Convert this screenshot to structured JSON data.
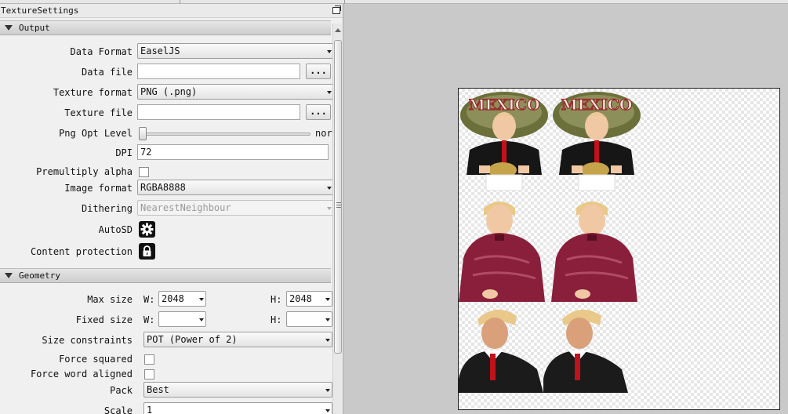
{
  "panel": {
    "title": "TextureSettings",
    "sections": {
      "output": "Output",
      "geometry": "Geometry"
    }
  },
  "output": {
    "data_format_label": "Data Format",
    "data_format_value": "EaselJS",
    "data_file_label": "Data file",
    "data_file_value": "",
    "browse_label": "...",
    "texture_format_label": "Texture format",
    "texture_format_value": "PNG (.png)",
    "texture_file_label": "Texture file",
    "texture_file_value": "",
    "png_opt_label": "Png Opt Level",
    "png_opt_value_text": "nor",
    "dpi_label": "DPI",
    "dpi_value": "72",
    "premultiply_label": "Premultiply alpha",
    "image_format_label": "Image format",
    "image_format_value": "RGBA8888",
    "dithering_label": "Dithering",
    "dithering_value": "NearestNeighbour",
    "autosd_label": "AutoSD",
    "content_protection_label": "Content protection"
  },
  "geometry": {
    "max_size_label": "Max size",
    "fixed_size_label": "Fixed size",
    "w_label": "W:",
    "h_label": "H:",
    "max_w": "2048",
    "max_h": "2048",
    "fixed_w": "",
    "fixed_h": "",
    "size_constraints_label": "Size constraints",
    "size_constraints_value": "POT (Power of 2)",
    "force_squared_label": "Force squared",
    "force_word_label": "Force word aligned",
    "pack_label": "Pack",
    "pack_value": "Best",
    "scale_label": "Scale",
    "scale_value": "1"
  },
  "sprite_sheet": {
    "sprites": [
      {
        "name": "sombrero-sprite",
        "hat_text": "MEXICO"
      },
      {
        "name": "sombrero-sprite",
        "hat_text": "MEXICO"
      },
      {
        "name": "red-jacket-sprite"
      },
      {
        "name": "red-jacket-sprite"
      },
      {
        "name": "suit-sprite"
      },
      {
        "name": "suit-sprite"
      }
    ]
  },
  "colors": {
    "panel_bg": "#f0f0f0",
    "workspace_bg": "#c9c9c9",
    "jacket": "#8a1f3b",
    "hat": "#6b6f3a",
    "hair": "#e9c889",
    "tie": "#c0121a"
  }
}
